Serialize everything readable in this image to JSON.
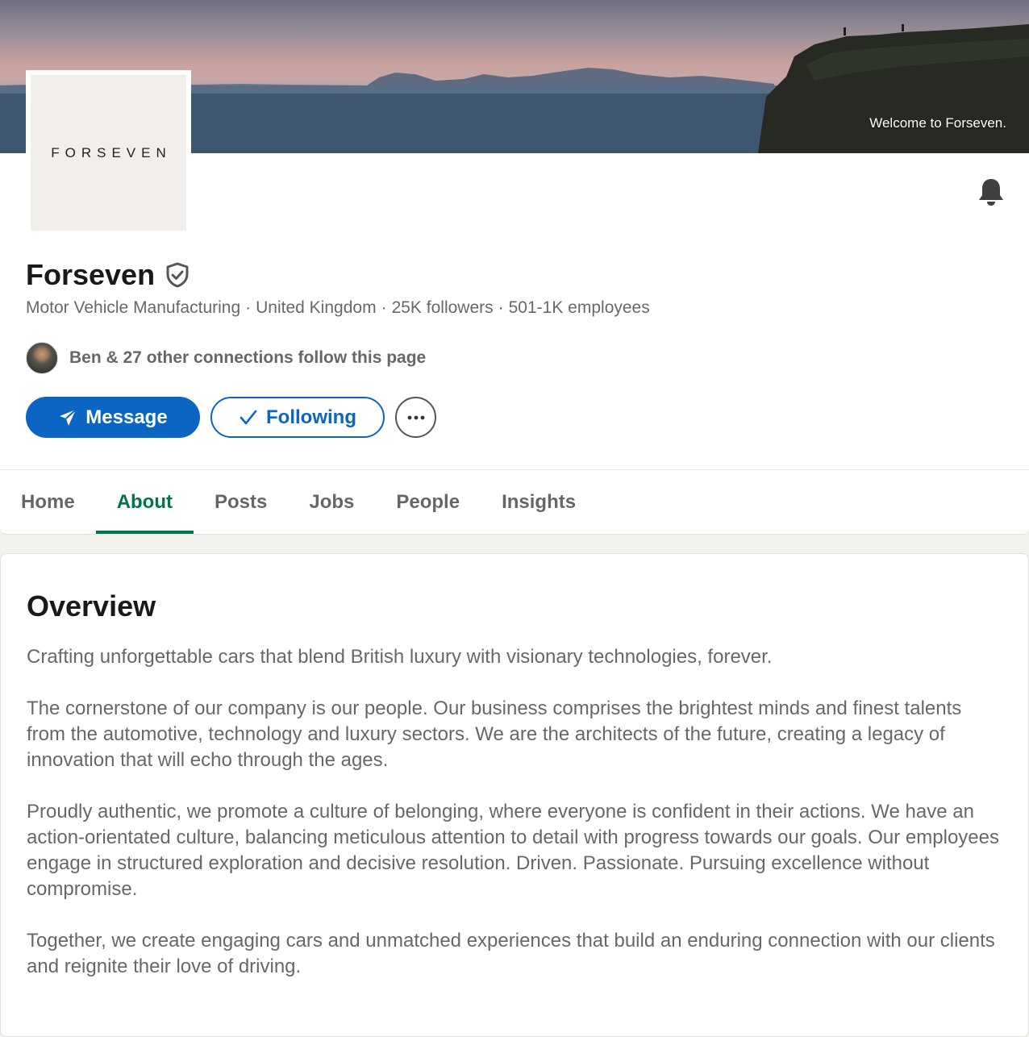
{
  "cover": {
    "caption": "Welcome to Forseven."
  },
  "company": {
    "logo_text": "FORSEVEN",
    "name": "Forseven",
    "industry": "Motor Vehicle Manufacturing",
    "location": "United Kingdom",
    "followers": "25K followers",
    "employees": "501-1K employees",
    "connections_text": "Ben & 27 other connections follow this page"
  },
  "actions": {
    "message_label": "Message",
    "following_label": "Following"
  },
  "tabs": [
    {
      "label": "Home",
      "active": false
    },
    {
      "label": "About",
      "active": true
    },
    {
      "label": "Posts",
      "active": false
    },
    {
      "label": "Jobs",
      "active": false
    },
    {
      "label": "People",
      "active": false
    },
    {
      "label": "Insights",
      "active": false
    }
  ],
  "overview": {
    "title": "Overview",
    "paragraphs": [
      "Crafting unforgettable cars that blend British luxury with visionary technologies, forever.",
      "The cornerstone of our company is our people. Our business comprises the brightest minds and finest talents from the automotive, technology and luxury sectors. We are the architects of the future, creating a legacy of innovation that will echo through the ages.",
      "Proudly authentic, we promote a culture of belonging, where everyone is confident in their actions. We have an action-orientated culture, balancing meticulous attention to detail with progress towards our goals. Our employees engage in structured exploration and decisive resolution. Driven. Passionate. Pursuing excellence without compromise.",
      "Together, we create engaging cars and unmatched experiences that build an enduring connection with our clients and reignite their love of driving."
    ]
  },
  "colors": {
    "brand_blue": "#0a66c2",
    "active_tab_green": "#01754f",
    "page_background": "#f4f2ee"
  },
  "icons": {
    "bell": "bell-icon",
    "verified": "verified-shield-icon",
    "message": "paper-plane-icon",
    "following": "checkmark-icon",
    "more": "ellipsis-icon"
  }
}
